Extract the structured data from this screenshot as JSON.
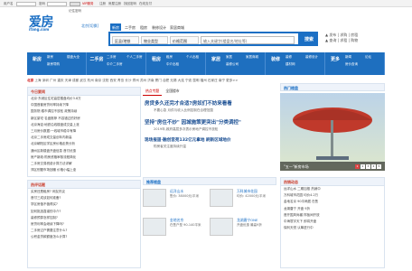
{
  "topbar": {
    "user_label": "用户名",
    "pass_label": "密码",
    "login_button": "登录",
    "vip_label": "VIP服务",
    "links": [
      "注册",
      "房屋注册",
      "找回密码",
      "在线支付"
    ],
    "remember": "记住密码"
  },
  "logo": {
    "main": "爱房",
    "sub": "ifang.com"
  },
  "city": {
    "name": "北京",
    "switch": "[切换]"
  },
  "search": {
    "tabs": [
      "二手房",
      "租房",
      "装修设计",
      "家居商城",
      "新房",
      "二手"
    ],
    "active_tab": "新房",
    "selects": [
      "区县/地铁",
      "物业类型",
      "价格范围"
    ],
    "placeholder": "输入关键字(楼盘名/地址等)",
    "button": "搜索"
  },
  "hotline": {
    "lines": [
      "▲ 发布 | 求购 | 房租",
      "▲ 查询 | 求租 | 购物"
    ]
  },
  "nav": {
    "blocks": [
      {
        "title": "新房",
        "links": [
          "新房",
          "楼盘大全",
          "新房导购"
        ]
      },
      {
        "title": "二手房",
        "links": [
          "二手房",
          "个人二手房",
          "中介二手房"
        ]
      },
      {
        "title": "租房",
        "links": [
          "租房",
          "个人出租",
          "中介出租"
        ]
      },
      {
        "title": "家居",
        "links": [
          "家居",
          "家居商城",
          "装修公司"
        ]
      },
      {
        "title": "装修",
        "links": [
          "装修",
          "装修设计",
          "建材网"
        ]
      },
      {
        "title": "更多",
        "links": [
          "新闻",
          "论坛",
          "房价查询"
        ]
      }
    ]
  },
  "subnav": {
    "city": "北京",
    "text": "上海 深圳 广州 重庆 天津 成都 武汉 杭州 南京 沈阳 西安 青岛 长沙 郑州 苏州 济南 厦门 合肥 无锡 大连 宁波 昆明 福州 石家庄 南宁 更多>>"
  },
  "left_col": {
    "title": "今日要闻",
    "items": [
      "北京·东城区住宅高层楼盘均价3.8万",
      "中国首套房贷利率持续下降",
      "国务院:楼市调控不放松 政策持续",
      "新区豪宅·名盘推荐 不容错过的好房",
      "北京海淀:地铁沿线楼盘成交量上涨",
      "三月房价数据:一线城市稳中有降",
      "北京二手房成交量创年内新高",
      "北京朝阳区学区房价格走势分析",
      "通州区新楼盘开盘信息 首付优惠",
      "房产新政:购房资格审核流程简化",
      "二手房交易税费计算方法详解",
      "郊区别墅市场回暖 价格小幅上涨",
      "北京四环以内新房供应持续紧张"
    ],
    "hot_title": "热评话题",
    "hot_items": [
      "买房还是租房? 网友热议",
      "首付三成该如何准备?",
      "学区房值不值得买?",
      "如何挑选靠谱的中介?",
      "装修预算怎样控制?",
      "房贷利率会继续下降吗?",
      "二手房过户需要注意什么?",
      "公积金贷款额度怎么计算?"
    ]
  },
  "center": {
    "tabs": [
      "热点专题",
      "全国楼市"
    ],
    "news": [
      {
        "title": "房贷多久还完才合适?房奴们不妨来看看",
        "summary": "不要心急 月供与收入比例控制在合理范围"
      },
      {
        "title": "坚持\"房住不炒\" 因城施策更突出\"分类调控\"",
        "summary": "2019年,政府高层多次表示房地产调控不放松"
      },
      {
        "title": "现场报道·融创宫苑132亿元拿地 刷新区域地价",
        "summary": "购房者关注度持续升温"
      }
    ],
    "promo_title": "推荐楼盘",
    "promos": [
      {
        "name": "远洋山水",
        "desc": "售价: 38000元/平米"
      },
      {
        "name": "万科城市花园",
        "desc": "均价: 42000元/平米"
      },
      {
        "name": "金地名京",
        "desc": "在售户型 90-140平米"
      },
      {
        "name": "龙湖唐宁ONE",
        "desc": "开盘优惠 最高9折"
      }
    ]
  },
  "right_col": {
    "hot_title": "热门楼盘",
    "photo_caption": "\"五一\"新房市场",
    "dots": [
      "1",
      "2",
      "3",
      "4",
      "5"
    ],
    "side_title": "热销动态",
    "side_items": [
      "远洋山水 二期加推 热销中",
      "万科城市花园 均价4.2万",
      "金地名京 90平两居 在售",
      "龙湖唐宁 开盘 9折",
      "首开国风尚樾 样板间开放",
      "中海寰宇天下 即将开盘",
      "保利天悦 认筹进行中"
    ]
  }
}
